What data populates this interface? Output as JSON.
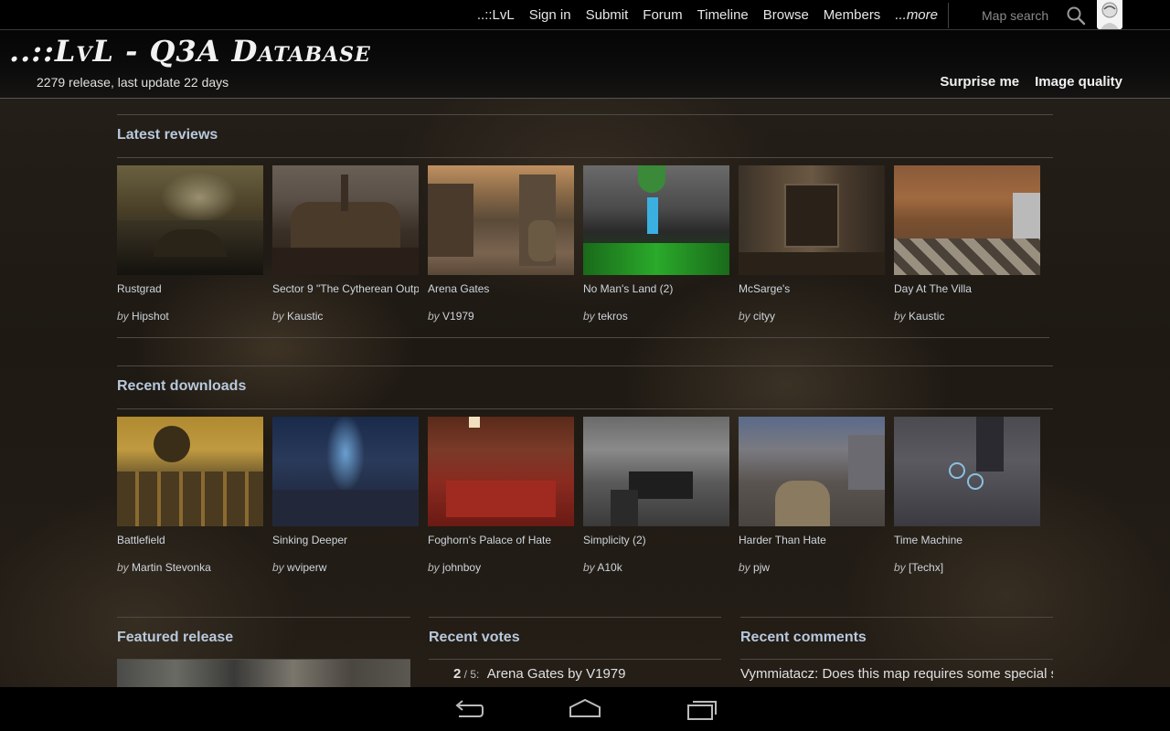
{
  "nav": {
    "items": [
      "..::LvL",
      "Sign in",
      "Submit",
      "Forum",
      "Timeline",
      "Browse",
      "Members",
      "...more"
    ],
    "search_placeholder": "Map search"
  },
  "header": {
    "logo": "..::LvL - Q3A Database",
    "subtitle": "2279 release, last update 22 days",
    "links": [
      "Surprise me",
      "Image quality"
    ]
  },
  "latest_reviews": {
    "title": "Latest reviews",
    "items": [
      {
        "title": "Rustgrad",
        "by": "by",
        "author": "Hipshot"
      },
      {
        "title": "Sector 9 \"The Cytherean Outp",
        "by": "by",
        "author": "Kaustic"
      },
      {
        "title": "Arena Gates",
        "by": "by",
        "author": "V1979"
      },
      {
        "title": "No Man's Land (2)",
        "by": "by",
        "author": "tekros"
      },
      {
        "title": "McSarge's",
        "by": "by",
        "author": "cityy"
      },
      {
        "title": "Day At The Villa",
        "by": "by",
        "author": "Kaustic"
      }
    ]
  },
  "recent_downloads": {
    "title": "Recent downloads",
    "items": [
      {
        "title": "Battlefield",
        "by": "by",
        "author": "Martin Stevonka"
      },
      {
        "title": "Sinking Deeper",
        "by": "by",
        "author": "wviperw"
      },
      {
        "title": "Foghorn's Palace of Hate",
        "by": "by",
        "author": "johnboy"
      },
      {
        "title": "Simplicity (2)",
        "by": "by",
        "author": "A10k"
      },
      {
        "title": "Harder Than Hate",
        "by": "by",
        "author": "pjw"
      },
      {
        "title": "Time Machine",
        "by": "by",
        "author": "[Techx]"
      }
    ]
  },
  "featured": {
    "title": "Featured release"
  },
  "recent_votes": {
    "title": "Recent votes",
    "first": {
      "score": "2",
      "outof": " / 5:",
      "text": "Arena Gates by V1979"
    }
  },
  "recent_comments": {
    "title": "Recent comments",
    "first": "Vymmiatacz: Does this map requires some special s"
  },
  "system_nav": [
    "back-icon",
    "home-icon",
    "recents-icon"
  ]
}
